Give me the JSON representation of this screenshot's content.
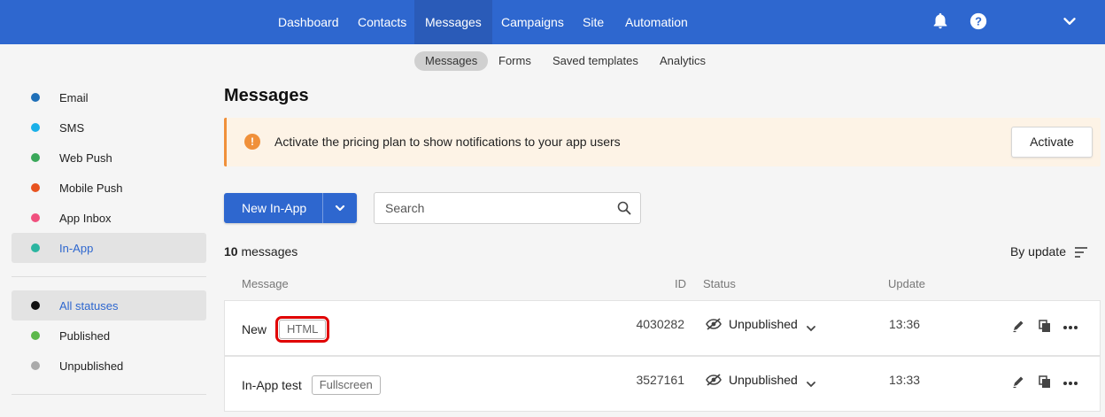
{
  "topnav": {
    "items": [
      {
        "label": "Dashboard"
      },
      {
        "label": "Contacts"
      },
      {
        "label": "Messages"
      },
      {
        "label": "Campaigns"
      },
      {
        "label": "Site"
      },
      {
        "label": "Automation"
      }
    ],
    "active": "Messages",
    "icons": [
      "bell-icon",
      "help-icon",
      "chevron-down-icon"
    ]
  },
  "subnav": {
    "items": [
      {
        "label": "Messages"
      },
      {
        "label": "Forms"
      },
      {
        "label": "Saved templates"
      },
      {
        "label": "Analytics"
      }
    ],
    "active": "Messages"
  },
  "sidebar": {
    "channels": [
      {
        "label": "Email",
        "color": "#1f6fb8"
      },
      {
        "label": "SMS",
        "color": "#1ab0e8"
      },
      {
        "label": "Web Push",
        "color": "#3aa85a"
      },
      {
        "label": "Mobile Push",
        "color": "#e8531f"
      },
      {
        "label": "App Inbox",
        "color": "#f0507e"
      },
      {
        "label": "In-App",
        "color": "#2bb5a0"
      }
    ],
    "active_channel": "In-App",
    "statuses": [
      {
        "label": "All statuses",
        "color": "#111111"
      },
      {
        "label": "Published",
        "color": "#5cb84a"
      },
      {
        "label": "Unpublished",
        "color": "#aaaaaa"
      }
    ],
    "active_status": "All statuses"
  },
  "page": {
    "title": "Messages"
  },
  "banner": {
    "text": "Activate the pricing plan to show notifications to your app users",
    "button": "Activate",
    "icon": "warning-icon",
    "accent": "#f0903a"
  },
  "toolbar": {
    "new_button": "New In-App",
    "search_placeholder": "Search"
  },
  "list": {
    "count": "10",
    "count_suffix": "messages",
    "sort_label": "By update",
    "columns": [
      "Message",
      "ID",
      "Status",
      "Update"
    ],
    "rows": [
      {
        "name": "New",
        "tag": "HTML",
        "id": "4030282",
        "status": "Unpublished",
        "update": "13:36"
      },
      {
        "name": "In-App test",
        "tag": "Fullscreen",
        "id": "3527161",
        "status": "Unpublished",
        "update": "13:33"
      }
    ]
  },
  "colors": {
    "brand": "#2e67cf",
    "highlight": "#e00000"
  }
}
